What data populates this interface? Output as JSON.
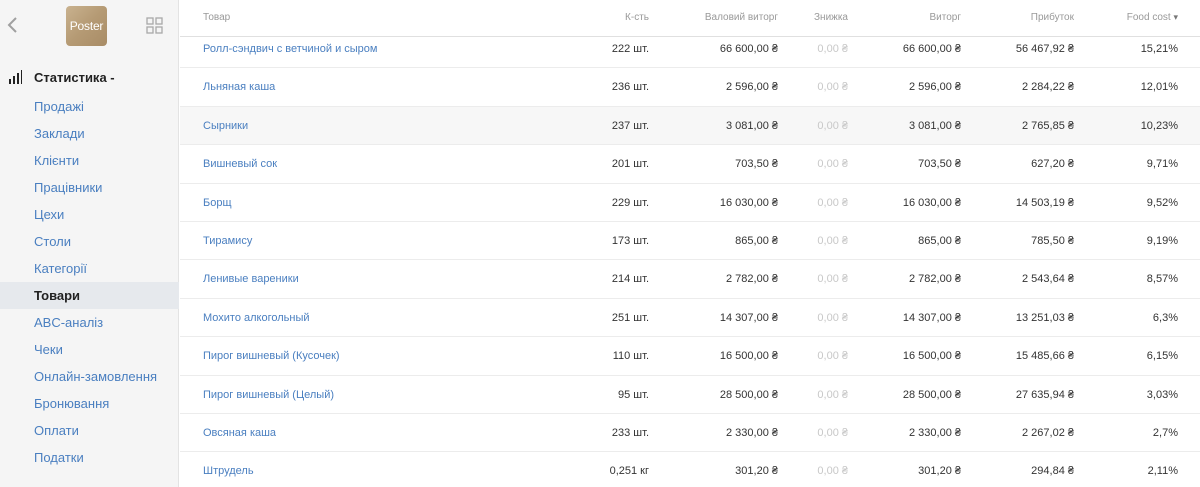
{
  "sidebar": {
    "logo_text": "Poster",
    "section_title": "Статистика -",
    "items": [
      {
        "label": "Продажі",
        "active": false
      },
      {
        "label": "Заклади",
        "active": false
      },
      {
        "label": "Клієнти",
        "active": false
      },
      {
        "label": "Працівники",
        "active": false
      },
      {
        "label": "Цехи",
        "active": false
      },
      {
        "label": "Столи",
        "active": false
      },
      {
        "label": "Категорії",
        "active": false
      },
      {
        "label": "Товари",
        "active": true
      },
      {
        "label": "ABC-аналіз",
        "active": false
      },
      {
        "label": "Чеки",
        "active": false
      },
      {
        "label": "Онлайн-замовлення",
        "active": false
      },
      {
        "label": "Бронювання",
        "active": false
      },
      {
        "label": "Оплати",
        "active": false
      },
      {
        "label": "Податки",
        "active": false
      }
    ]
  },
  "table": {
    "headers": {
      "name": "Товар",
      "qty": "К-сть",
      "gross": "Валовий виторг",
      "discount": "Знижка",
      "revenue": "Виторг",
      "profit": "Прибуток",
      "food_cost": "Food cost"
    },
    "sort_indicator": "▾",
    "rows": [
      {
        "name": "Ролл-сэндвич с ветчиной и сыром",
        "qty": "222 шт.",
        "gross": "66 600,00 ₴",
        "discount": "0,00 ₴",
        "revenue": "66 600,00 ₴",
        "profit": "56 467,92 ₴",
        "food_cost": "15,21%"
      },
      {
        "name": "Льняная каша",
        "qty": "236 шт.",
        "gross": "2 596,00 ₴",
        "discount": "0,00 ₴",
        "revenue": "2 596,00 ₴",
        "profit": "2 284,22 ₴",
        "food_cost": "12,01%"
      },
      {
        "name": "Сырники",
        "qty": "237 шт.",
        "gross": "3 081,00 ₴",
        "discount": "0,00 ₴",
        "revenue": "3 081,00 ₴",
        "profit": "2 765,85 ₴",
        "food_cost": "10,23%"
      },
      {
        "name": "Вишневый сок",
        "qty": "201 шт.",
        "gross": "703,50 ₴",
        "discount": "0,00 ₴",
        "revenue": "703,50 ₴",
        "profit": "627,20 ₴",
        "food_cost": "9,71%"
      },
      {
        "name": "Борщ",
        "qty": "229 шт.",
        "gross": "16 030,00 ₴",
        "discount": "0,00 ₴",
        "revenue": "16 030,00 ₴",
        "profit": "14 503,19 ₴",
        "food_cost": "9,52%"
      },
      {
        "name": "Тирамису",
        "qty": "173 шт.",
        "gross": "865,00 ₴",
        "discount": "0,00 ₴",
        "revenue": "865,00 ₴",
        "profit": "785,50 ₴",
        "food_cost": "9,19%"
      },
      {
        "name": "Ленивые вареники",
        "qty": "214 шт.",
        "gross": "2 782,00 ₴",
        "discount": "0,00 ₴",
        "revenue": "2 782,00 ₴",
        "profit": "2 543,64 ₴",
        "food_cost": "8,57%"
      },
      {
        "name": "Мохито алкогольный",
        "qty": "251 шт.",
        "gross": "14 307,00 ₴",
        "discount": "0,00 ₴",
        "revenue": "14 307,00 ₴",
        "profit": "13 251,03 ₴",
        "food_cost": "6,3%"
      },
      {
        "name": "Пирог вишневый (Кусочек)",
        "qty": "110 шт.",
        "gross": "16 500,00 ₴",
        "discount": "0,00 ₴",
        "revenue": "16 500,00 ₴",
        "profit": "15 485,66 ₴",
        "food_cost": "6,15%"
      },
      {
        "name": "Пирог вишневый (Целый)",
        "qty": "95 шт.",
        "gross": "28 500,00 ₴",
        "discount": "0,00 ₴",
        "revenue": "28 500,00 ₴",
        "profit": "27 635,94 ₴",
        "food_cost": "3,03%"
      },
      {
        "name": "Овсяная каша",
        "qty": "233 шт.",
        "gross": "2 330,00 ₴",
        "discount": "0,00 ₴",
        "revenue": "2 330,00 ₴",
        "profit": "2 267,02 ₴",
        "food_cost": "2,7%"
      },
      {
        "name": "Штрудель",
        "qty": "0,251 кг",
        "gross": "301,20 ₴",
        "discount": "0,00 ₴",
        "revenue": "301,20 ₴",
        "profit": "294,84 ₴",
        "food_cost": "2,11%"
      }
    ]
  },
  "colors": {
    "link": "#4a7fc0",
    "sidebar_bg": "#f5f5f5",
    "active_item_bg": "#e6e9ed",
    "muted": "#c8c8c8"
  }
}
